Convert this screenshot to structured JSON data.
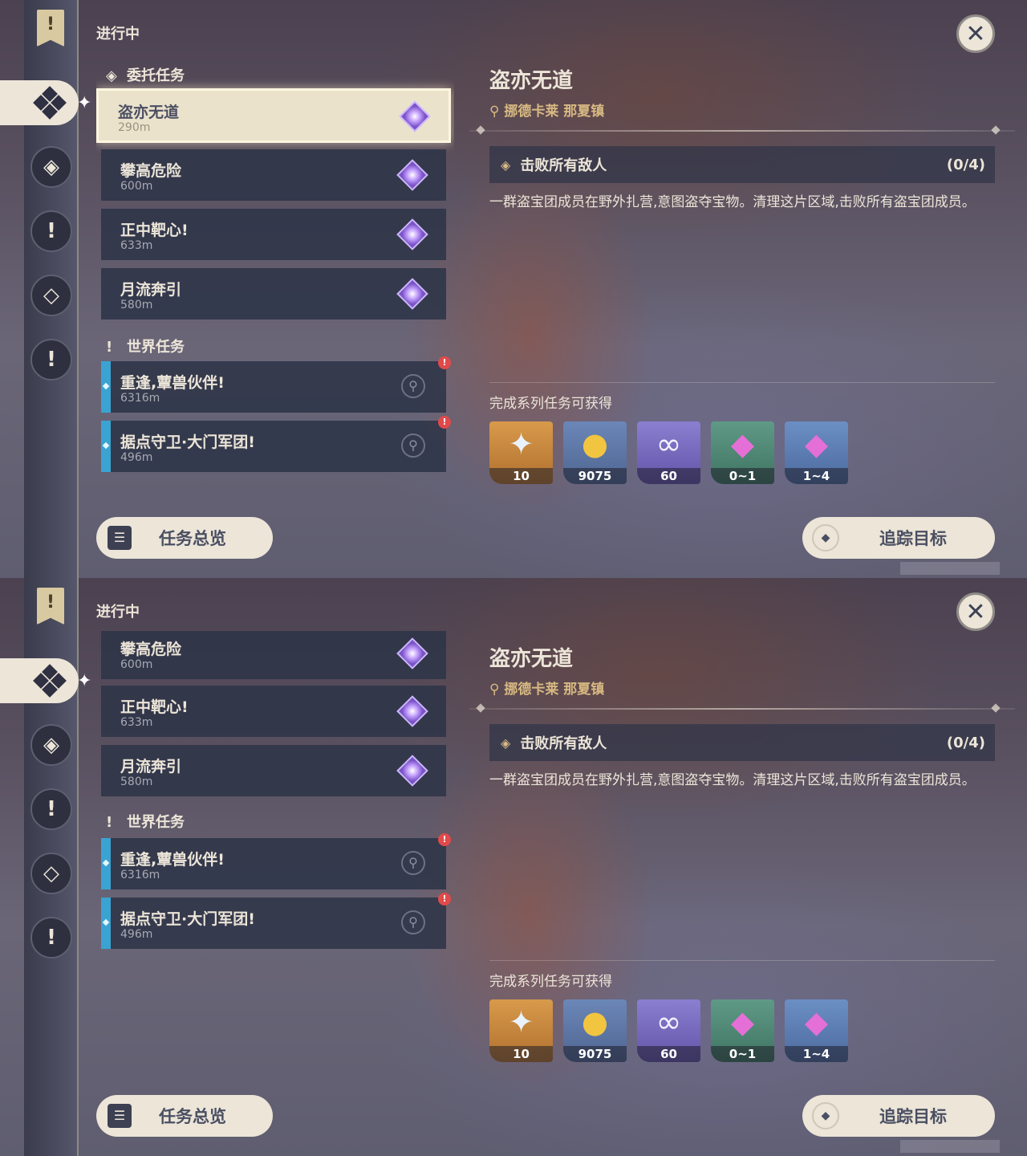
{
  "header": {
    "section": "进行中",
    "close_icon": "close-icon"
  },
  "rail": {
    "items": [
      "banner-icon",
      "commission-icon",
      "archon-icon",
      "world-quest-icon",
      "event-icon",
      "alert-icon"
    ]
  },
  "groups": {
    "commission": "委托任务",
    "world": "世界任务"
  },
  "quests": [
    {
      "title": "盗亦无道",
      "dist": "290m"
    },
    {
      "title": "攀高危险",
      "dist": "600m"
    },
    {
      "title": "正中靶心!",
      "dist": "633m"
    },
    {
      "title": "月流奔引",
      "dist": "580m"
    }
  ],
  "world_quests": [
    {
      "title": "重逢,蕈兽伙伴!",
      "dist": "6316m"
    },
    {
      "title": "据点守卫·大门军团!",
      "dist": "496m"
    }
  ],
  "detail": {
    "title": "盗亦无道",
    "location": "挪德卡莱 那夏镇",
    "objective": "击败所有敌人",
    "progress": "(0/4)",
    "description": "一群盗宝团成员在野外扎营,意图盗夺宝物。清理这片区域,击败所有盗宝团成员。",
    "reward_title": "完成系列任务可获得",
    "rewards": [
      {
        "name": "primogem",
        "count": "10"
      },
      {
        "name": "mora",
        "count": "9075"
      },
      {
        "name": "companionship-exp",
        "count": "60"
      },
      {
        "name": "crystal-chunk",
        "count": "0~1"
      },
      {
        "name": "crystal-cluster",
        "count": "1~4"
      }
    ]
  },
  "buttons": {
    "overview": "任务总览",
    "track": "追踪目标"
  }
}
